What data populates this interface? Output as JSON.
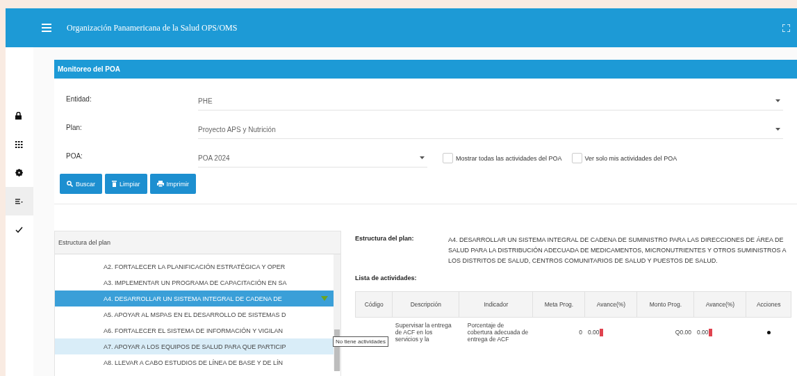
{
  "header": {
    "title": "Organización Panamericana de la Salud  OPS/OMS"
  },
  "sidebar": {
    "items": [
      {
        "selected": false
      },
      {
        "selected": false
      },
      {
        "selected": false
      },
      {
        "selected": true
      },
      {
        "selected": false
      }
    ]
  },
  "card": {
    "title": "Monitoreo del POA"
  },
  "form": {
    "fields": [
      {
        "label": "Entidad:",
        "value": "PHE",
        "kind": "wide"
      },
      {
        "label": "Plan:",
        "value": "Proyecto APS y Nutrición",
        "kind": "wide"
      },
      {
        "label": "POA:",
        "value": "POA 2024",
        "kind": "narrow"
      }
    ],
    "checkboxes": [
      {
        "label": "Mostrar todas las actividades del POA",
        "checked": false
      },
      {
        "label": "Ver solo mis actividades del POA",
        "checked": false
      }
    ],
    "buttons": [
      {
        "label": "Buscar"
      },
      {
        "label": "Limpiar"
      },
      {
        "label": "Imprimir"
      }
    ]
  },
  "tree": {
    "header": "Estructura del plan",
    "items": [
      {
        "label": "A2. FORTALECER LA PLANIFICACIÓN ESTRATÉGICA Y OPER",
        "selected": false,
        "hovered": false
      },
      {
        "label": "A3. IMPLEMENTAR UN PROGRAMA DE CAPACITACIÓN EN SA",
        "selected": false,
        "hovered": false
      },
      {
        "label": "A4. DESARROLLAR UN SISTEMA INTEGRAL DE CADENA DE",
        "selected": true,
        "hovered": false
      },
      {
        "label": "A5. APOYAR AL MSPAS EN EL DESARROLLO DE SISTEMAS D",
        "selected": false,
        "hovered": false
      },
      {
        "label": "A6. FORTALECER EL SISTEMA DE INFORMACIÓN Y VIGILAN",
        "selected": false,
        "hovered": false
      },
      {
        "label": "A7. APOYAR A LOS EQUIPOS DE SALUD PARA QUE PARTICIP",
        "selected": false,
        "hovered": true
      },
      {
        "label": "A8. LLEVAR A CABO ESTUDIOS DE LÍNEA DE BASE Y DE LÍN",
        "selected": false,
        "hovered": false
      }
    ]
  },
  "detail": {
    "structure_label": "Estructura del plan:",
    "structure_value": "A4. DESARROLLAR UN SISTEMA INTEGRAL DE CADENA DE SUMINISTRO PARA LAS DIRECCIONES DE ÁREA DE SALUD PARA LA DISTRIBUCIÓN ADECUADA DE MEDICAMENTOS, MICRONUTRIENTES Y OTROS SUMINISTROS A LOS DISTRITOS DE SALUD, CENTROS COMUNITARIOS DE SALUD Y PUESTOS DE SALUD.",
    "activities_label": "Lista de actividades:",
    "table": {
      "columns": [
        "Código",
        "Descripción",
        "Indicador",
        "Meta Prog.",
        "Avance(%)",
        "Monto Prog.",
        "Avance(%)",
        "Acciones"
      ],
      "rows": [
        {
          "descripcion": "Supervisar la entrega de ACF en los servicios y la",
          "indicador": "Porcentaje de cobertura adecuada de entrega de ACF",
          "meta": "0",
          "avance": "0.00",
          "monto": "Q0.00",
          "avance_monto": "0.00"
        }
      ]
    }
  },
  "tooltip": "No tiene actividades"
}
